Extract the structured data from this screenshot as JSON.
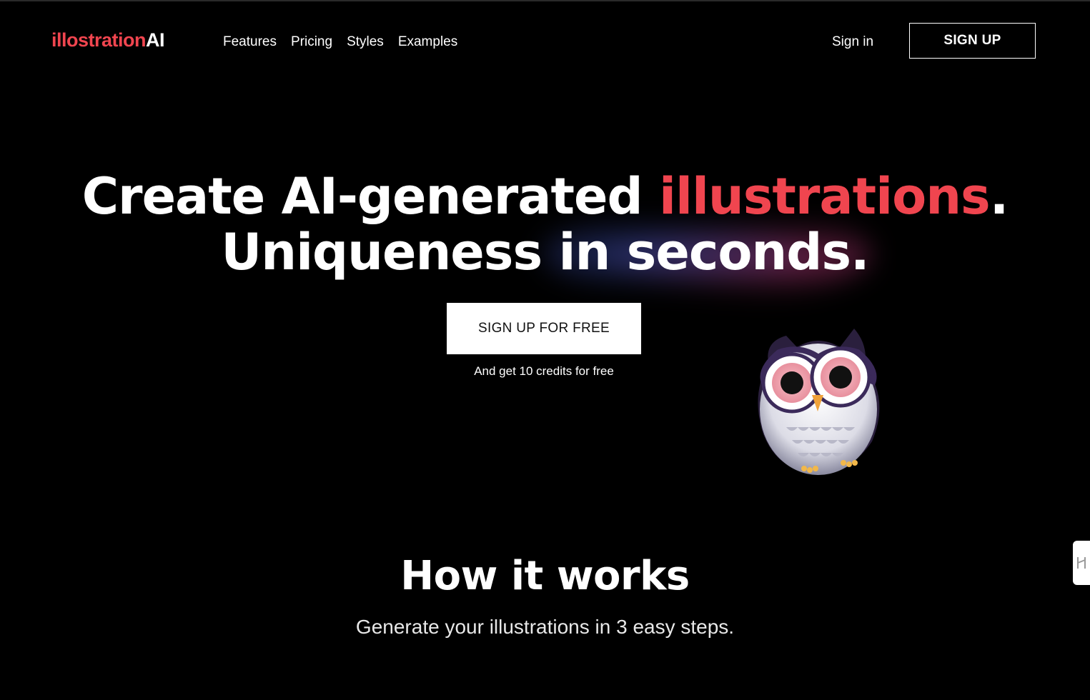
{
  "brand": {
    "logo_part1": "illostration",
    "logo_part2": "AI",
    "accent_color": "#f0454f"
  },
  "nav": {
    "items": [
      {
        "label": "Features"
      },
      {
        "label": "Pricing"
      },
      {
        "label": "Styles"
      },
      {
        "label": "Examples"
      }
    ],
    "signin_label": "Sign in",
    "signup_label": "SIGN UP"
  },
  "hero": {
    "line1_part1": "Create AI-generated ",
    "line1_accent": "illustrations",
    "line1_end": ".",
    "line2": "Uniqueness in seconds.",
    "cta_label": "SIGN UP FOR FREE",
    "cta_subtext": "And get 10 credits for free",
    "illustration_icon": "owl-illustration"
  },
  "how_it_works": {
    "title": "How it works",
    "subtitle": "Generate your illustrations in 3 easy steps."
  },
  "side_widget": {
    "icon": "widget-tab-icon"
  }
}
